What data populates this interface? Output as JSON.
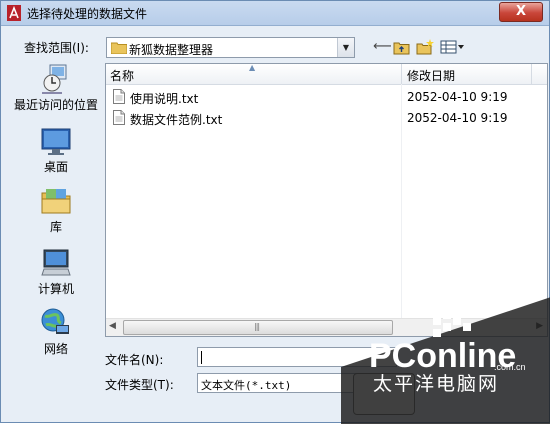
{
  "window": {
    "title": "选择待处理的数据文件",
    "close_label": "X"
  },
  "lookin": {
    "label": "查找范围(I):",
    "value": "新狐数据整理器"
  },
  "places": [
    {
      "label": "最近访问的位置",
      "icon": "recent-places-icon"
    },
    {
      "label": "桌面",
      "icon": "desktop-icon"
    },
    {
      "label": "库",
      "icon": "libraries-icon"
    },
    {
      "label": "计算机",
      "icon": "computer-icon"
    },
    {
      "label": "网络",
      "icon": "network-icon"
    }
  ],
  "filelist": {
    "columns": {
      "name": "名称",
      "date": "修改日期"
    },
    "rows": [
      {
        "name": "使用说明.txt",
        "date": "2052-04-10 9:19"
      },
      {
        "name": "数据文件范例.txt",
        "date": "2052-04-10 9:19"
      }
    ]
  },
  "filename": {
    "label": "文件名(N):",
    "value": ""
  },
  "filetype": {
    "label": "文件类型(T):",
    "value": "文本文件(*.txt)"
  },
  "watermark": {
    "brand": "PConline",
    "domain": ".com.cn",
    "tagline": "太平洋电脑网"
  },
  "colors": {
    "accent": "#6b8cb3",
    "close": "#c9463a"
  }
}
